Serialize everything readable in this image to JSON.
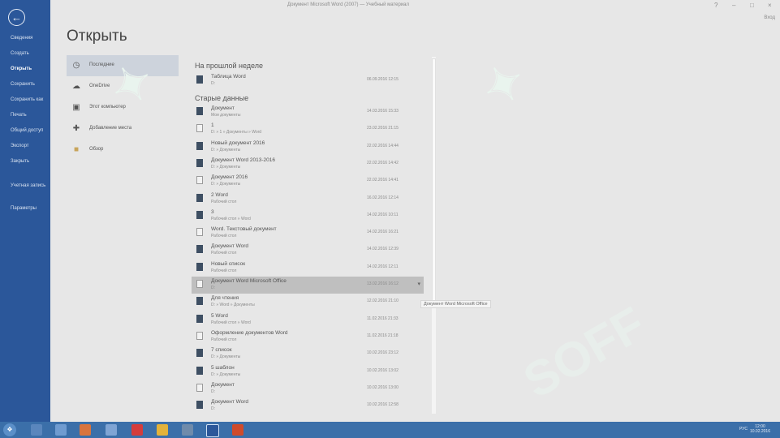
{
  "window": {
    "title": "Документ Microsoft Word (2007) — Учебный материал",
    "login": "Вход"
  },
  "nav": {
    "items": [
      {
        "label": "Сведения"
      },
      {
        "label": "Создать"
      },
      {
        "label": "Открыть"
      },
      {
        "label": "Сохранить"
      },
      {
        "label": "Сохранить как"
      },
      {
        "label": "Печать"
      },
      {
        "label": "Общий доступ"
      },
      {
        "label": "Экспорт"
      },
      {
        "label": "Закрыть"
      },
      {
        "label": "Учетная запись"
      },
      {
        "label": "Параметры"
      }
    ]
  },
  "page": {
    "title": "Открыть"
  },
  "places": [
    {
      "label": "Последние",
      "icon": "clock-icon"
    },
    {
      "label": "OneDrive",
      "icon": "cloud-icon"
    },
    {
      "label": "Этот компьютер",
      "icon": "computer-icon"
    },
    {
      "label": "Добавление места",
      "icon": "plus-icon"
    },
    {
      "label": "Обзор",
      "icon": "folder-icon"
    }
  ],
  "sections": {
    "last_week": "На прошлой неделе",
    "older": "Старые данные"
  },
  "files_last_week": [
    {
      "name": "Таблица Word",
      "path": "D:",
      "date": "06.09.2016 12:15"
    }
  ],
  "files_older": [
    {
      "name": "Документ",
      "path": "Мои документы",
      "date": "14.03.2016 15:33"
    },
    {
      "name": "1",
      "path": "D: » 1 » Документы » Word",
      "date": "23.02.2016 21:15"
    },
    {
      "name": "Новый документ 2016",
      "path": "D: » Документы",
      "date": "22.02.2016 14:44"
    },
    {
      "name": "Документ Word 2013-2016",
      "path": "D: » Документы",
      "date": "22.02.2016 14:42"
    },
    {
      "name": "Документ 2016",
      "path": "D: » Документы",
      "date": "22.02.2016 14:41"
    },
    {
      "name": "2 Word",
      "path": "Рабочий стол",
      "date": "16.02.2016 12:14"
    },
    {
      "name": "3",
      "path": "Рабочий стол » Word",
      "date": "14.02.2016 10:11"
    },
    {
      "name": "Word. Текстовый документ",
      "path": "Рабочий стол",
      "date": "14.02.2016 16:21"
    },
    {
      "name": "Документ Word",
      "path": "Рабочий стол",
      "date": "14.02.2016 12:39"
    },
    {
      "name": "Новый список",
      "path": "Рабочий стол",
      "date": "14.02.2016 12:11"
    },
    {
      "name": "Документ Word Microsoft Office",
      "path": "D:",
      "date": "13.02.2016 16:12"
    },
    {
      "name": "Для чтения",
      "path": "D: » Word » Документы",
      "date": "12.02.2016 21:10"
    },
    {
      "name": "5 Word",
      "path": "Рабочий стол » Word",
      "date": "11.02.2016 21:33"
    },
    {
      "name": "Оформление документов Word",
      "path": "Рабочий стол",
      "date": "11.02.2016 21:18"
    },
    {
      "name": "7 список",
      "path": "D: » Документы",
      "date": "10.02.2016 23:12"
    },
    {
      "name": "5 шаблон",
      "path": "D: » Документы",
      "date": "10.02.2016 13:02"
    },
    {
      "name": "Документ",
      "path": "D:",
      "date": "10.02.2016 13:00"
    },
    {
      "name": "Документ Word",
      "path": "D:",
      "date": "10.02.2016 12:58"
    }
  ],
  "tooltip": "Документ Word Microsoft Office",
  "taskbar": {
    "tray": "РУС",
    "time": "12:00",
    "date": "10.02.2016"
  },
  "watermark": "SOFF"
}
